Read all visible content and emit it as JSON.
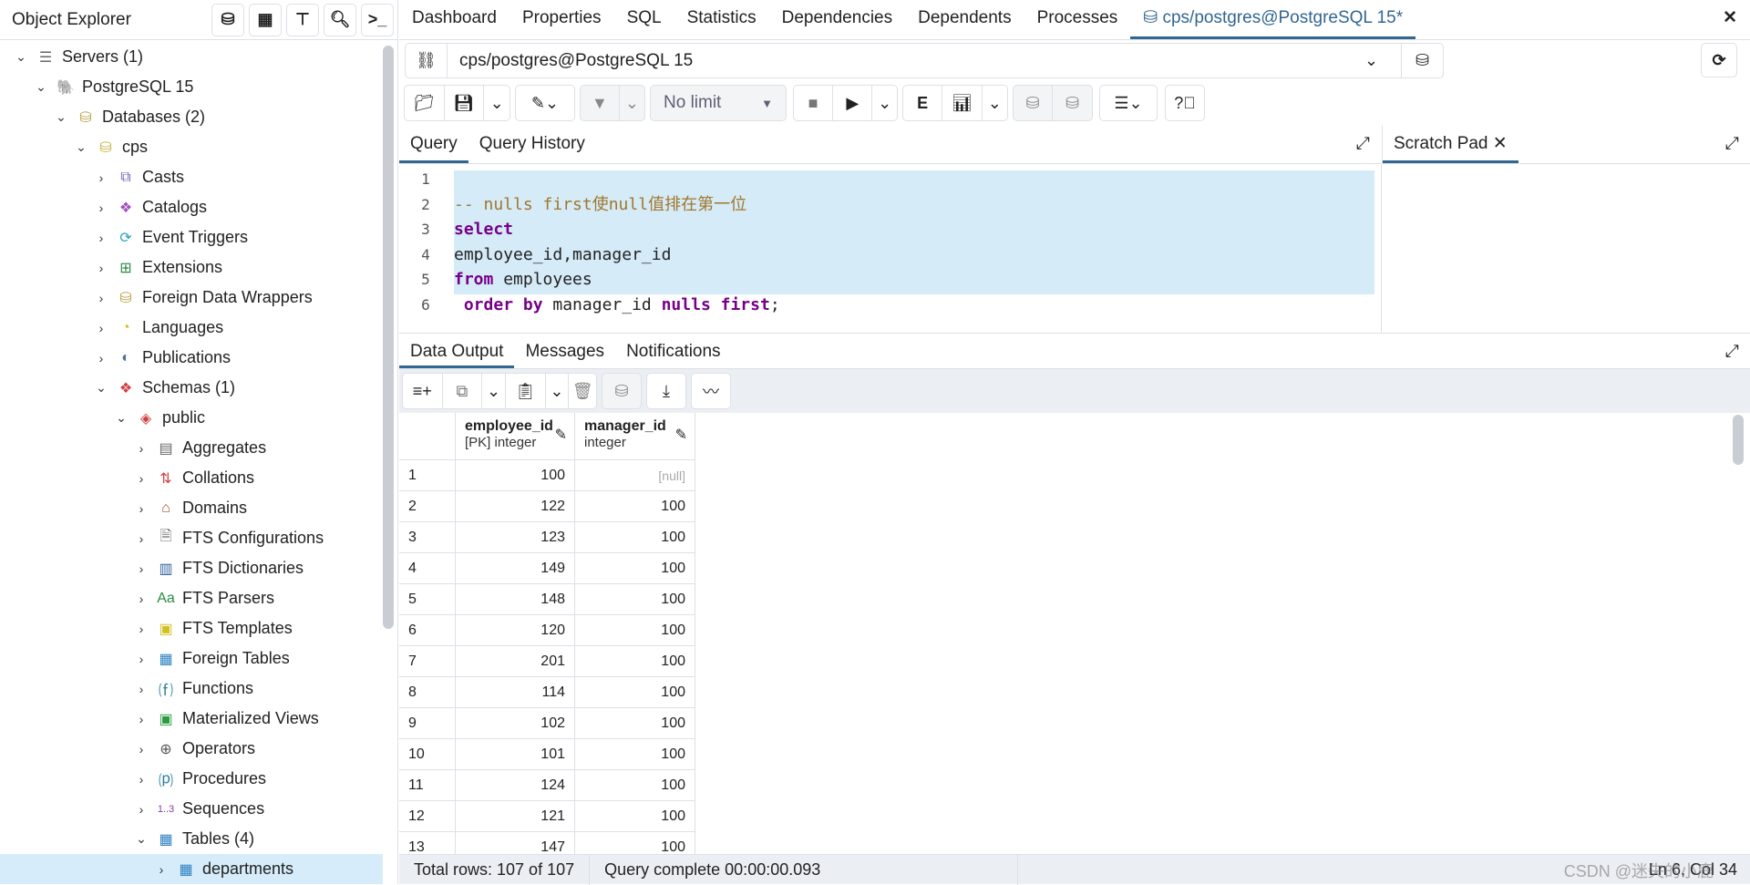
{
  "object_explorer": {
    "title": "Object Explorer",
    "tree": [
      {
        "label": "Servers (1)",
        "level": 0,
        "exp": "open",
        "icon": "server-icon",
        "glyph": "☰",
        "color": "#666"
      },
      {
        "label": "PostgreSQL 15",
        "level": 1,
        "exp": "open",
        "icon": "postgres-elephant-icon",
        "glyph": "🐘",
        "color": "#336791"
      },
      {
        "label": "Databases (2)",
        "level": 2,
        "exp": "open",
        "icon": "databases-icon",
        "glyph": "⛁",
        "color": "#b8a040"
      },
      {
        "label": "cps",
        "level": 3,
        "exp": "open",
        "icon": "database-icon",
        "glyph": "⛁",
        "color": "#c4b040"
      },
      {
        "label": "Casts",
        "level": 4,
        "exp": "closed",
        "icon": "casts-icon",
        "glyph": "⧉",
        "color": "#6b5fc7"
      },
      {
        "label": "Catalogs",
        "level": 4,
        "exp": "closed",
        "icon": "catalogs-icon",
        "glyph": "❖",
        "color": "#a050c0"
      },
      {
        "label": "Event Triggers",
        "level": 4,
        "exp": "closed",
        "icon": "event-triggers-icon",
        "glyph": "⟳",
        "color": "#2aa0c0"
      },
      {
        "label": "Extensions",
        "level": 4,
        "exp": "closed",
        "icon": "extensions-icon",
        "glyph": "⊞",
        "color": "#2a8a40"
      },
      {
        "label": "Foreign Data Wrappers",
        "level": 4,
        "exp": "closed",
        "icon": "foreign-data-wrappers-icon",
        "glyph": "⛁",
        "color": "#b8a040"
      },
      {
        "label": "Languages",
        "level": 4,
        "exp": "closed",
        "icon": "languages-icon",
        "glyph": "◔",
        "color": "#d0c020"
      },
      {
        "label": "Publications",
        "level": 4,
        "exp": "closed",
        "icon": "publications-icon",
        "glyph": "◐",
        "color": "#5070a0"
      },
      {
        "label": "Schemas (1)",
        "level": 4,
        "exp": "open",
        "icon": "schemas-icon",
        "glyph": "❖",
        "color": "#d04040"
      },
      {
        "label": "public",
        "level": 5,
        "exp": "open",
        "icon": "schema-icon",
        "glyph": "◈",
        "color": "#d04040"
      },
      {
        "label": "Aggregates",
        "level": 6,
        "exp": "closed",
        "icon": "aggregates-icon",
        "glyph": "▤",
        "color": "#666"
      },
      {
        "label": "Collations",
        "level": 6,
        "exp": "closed",
        "icon": "collations-icon",
        "glyph": "⇅",
        "color": "#d04040"
      },
      {
        "label": "Domains",
        "level": 6,
        "exp": "closed",
        "icon": "domains-icon",
        "glyph": "⌂",
        "color": "#a05030"
      },
      {
        "label": "FTS Configurations",
        "level": 6,
        "exp": "closed",
        "icon": "fts-configurations-icon",
        "glyph": "🗎",
        "color": "#666"
      },
      {
        "label": "FTS Dictionaries",
        "level": 6,
        "exp": "closed",
        "icon": "fts-dictionaries-icon",
        "glyph": "▥",
        "color": "#3060a0"
      },
      {
        "label": "FTS Parsers",
        "level": 6,
        "exp": "closed",
        "icon": "fts-parsers-icon",
        "glyph": "Aa",
        "color": "#2a8a40"
      },
      {
        "label": "FTS Templates",
        "level": 6,
        "exp": "closed",
        "icon": "fts-templates-icon",
        "glyph": "▣",
        "color": "#d0c020"
      },
      {
        "label": "Foreign Tables",
        "level": 6,
        "exp": "closed",
        "icon": "foreign-tables-icon",
        "glyph": "▦",
        "color": "#2a80c0"
      },
      {
        "label": "Functions",
        "level": 6,
        "exp": "closed",
        "icon": "functions-icon",
        "glyph": "⒡",
        "color": "#2a80a0"
      },
      {
        "label": "Materialized Views",
        "level": 6,
        "exp": "closed",
        "icon": "materialized-views-icon",
        "glyph": "▣",
        "color": "#2a9a40"
      },
      {
        "label": "Operators",
        "level": 6,
        "exp": "closed",
        "icon": "operators-icon",
        "glyph": "⊕",
        "color": "#555"
      },
      {
        "label": "Procedures",
        "level": 6,
        "exp": "closed",
        "icon": "procedures-icon",
        "glyph": "⒫",
        "color": "#2a80a0"
      },
      {
        "label": "Sequences",
        "level": 6,
        "exp": "closed",
        "icon": "sequences-icon",
        "glyph": "1..3",
        "color": "#8040a0"
      },
      {
        "label": "Tables (4)",
        "level": 6,
        "exp": "open",
        "icon": "tables-icon",
        "glyph": "▦",
        "color": "#2a80c0"
      },
      {
        "label": "departments",
        "level": 7,
        "exp": "closed",
        "icon": "table-icon",
        "glyph": "▦",
        "color": "#2a80c0",
        "selected": true
      }
    ]
  },
  "tabs": [
    "Dashboard",
    "Properties",
    "SQL",
    "Statistics",
    "Dependencies",
    "Dependents",
    "Processes",
    "cps/postgres@PostgreSQL 15*"
  ],
  "connection": "cps/postgres@PostgreSQL 15",
  "toolbar": {
    "limit": "No limit"
  },
  "query_tabs": [
    "Query",
    "Query History"
  ],
  "scratch_pad": "Scratch Pad",
  "editor": {
    "lines": [
      "",
      "-- nulls first使null值排在第一位",
      "select",
      "employee_id,manager_id",
      "from employees",
      " order by manager_id nulls first;"
    ]
  },
  "output_tabs": [
    "Data Output",
    "Messages",
    "Notifications"
  ],
  "grid": {
    "columns": [
      {
        "name": "employee_id",
        "type": "[PK] integer"
      },
      {
        "name": "manager_id",
        "type": "integer"
      }
    ],
    "rows": [
      [
        "100",
        "[null]"
      ],
      [
        "122",
        "100"
      ],
      [
        "123",
        "100"
      ],
      [
        "149",
        "100"
      ],
      [
        "148",
        "100"
      ],
      [
        "120",
        "100"
      ],
      [
        "201",
        "100"
      ],
      [
        "114",
        "100"
      ],
      [
        "102",
        "100"
      ],
      [
        "101",
        "100"
      ],
      [
        "124",
        "100"
      ],
      [
        "121",
        "100"
      ],
      [
        "147",
        "100"
      ]
    ]
  },
  "status": {
    "total_rows": "Total rows: 107 of 107",
    "query": "Query complete 00:00:00.093",
    "cursor": "Ln 6, Col 34"
  },
  "watermark": "CSDN @迷失的小鹿"
}
